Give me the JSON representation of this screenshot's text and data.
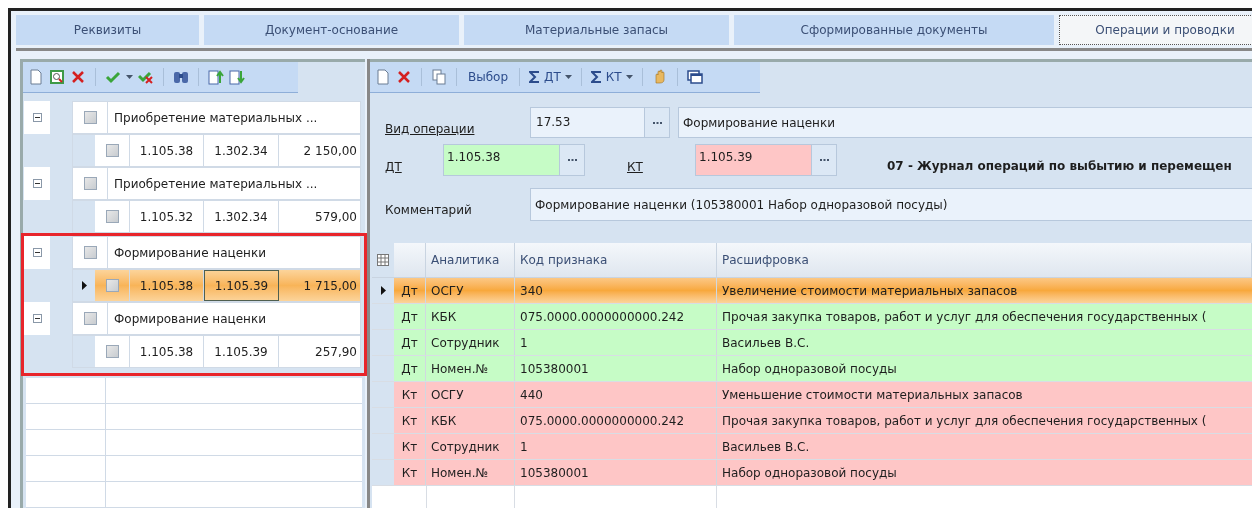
{
  "tabs": [
    {
      "label": "Реквизиты",
      "selected": false
    },
    {
      "label": "Документ-основание",
      "selected": false
    },
    {
      "label": "Материальные запасы",
      "selected": false
    },
    {
      "label": "Сформированные документы",
      "selected": false
    },
    {
      "label": "Операции и проводки",
      "selected": true
    }
  ],
  "tree": [
    {
      "label": "Приобретение материальных ...",
      "checked": false,
      "expanded": true,
      "highlighted": false,
      "children": [
        {
          "debit": "1.105.38",
          "credit": "1.302.34",
          "amount": "2 150,00",
          "checked": false,
          "selected": false
        }
      ]
    },
    {
      "label": "Приобретение материальных ...",
      "checked": false,
      "expanded": true,
      "highlighted": false,
      "children": [
        {
          "debit": "1.105.32",
          "credit": "1.302.34",
          "amount": "579,00",
          "checked": false,
          "selected": false
        }
      ]
    },
    {
      "label": "Формирование наценки",
      "checked": false,
      "expanded": true,
      "highlighted": true,
      "children": [
        {
          "debit": "1.105.38",
          "credit": "1.105.39",
          "amount": "1 715,00",
          "checked": false,
          "selected": true
        }
      ]
    },
    {
      "label": "Формирование наценки",
      "checked": false,
      "expanded": true,
      "highlighted": true,
      "children": [
        {
          "debit": "1.105.38",
          "credit": "1.105.39",
          "amount": "257,90",
          "checked": false,
          "selected": false
        }
      ]
    }
  ],
  "toolbar": {
    "choose": "Выбор",
    "sum_debit": "ДТ",
    "sum_credit": "КТ"
  },
  "form": {
    "operation_type": {
      "label": "Вид операции",
      "code": "17.53",
      "name": "Формирование наценки"
    },
    "debit": {
      "label": "ДТ",
      "value": "1.105.38"
    },
    "credit": {
      "label": "КТ",
      "value": "1.105.39"
    },
    "journal_title": "07 - Журнал операций по выбытию и перемещен",
    "comment": {
      "label": "Комментарий",
      "value": "Формирование наценки (105380001 Набор одноразовой посуды)"
    }
  },
  "grid": {
    "columns": [
      "Аналитика",
      "Код признака",
      "Расшифровка"
    ],
    "rows": [
      {
        "kind": "debit",
        "side": "Дт",
        "analytic": "ОСГУ",
        "code": "340",
        "description": "Увеличение стоимости материальных запасов",
        "selected": true
      },
      {
        "kind": "debit",
        "side": "Дт",
        "analytic": "КБК",
        "code": "075.0000.0000000000.242",
        "description": "Прочая закупка товаров, работ и услуг для обеспечения государственных (",
        "selected": false
      },
      {
        "kind": "debit",
        "side": "Дт",
        "analytic": "Сотрудник",
        "code": "1",
        "description": "Васильев В.С.",
        "selected": false
      },
      {
        "kind": "debit",
        "side": "Дт",
        "analytic": "Номен.№",
        "code": "105380001",
        "description": "Набор одноразовой посуды",
        "selected": false
      },
      {
        "kind": "credit",
        "side": "Кт",
        "analytic": "ОСГУ",
        "code": "440",
        "description": "Уменьшение стоимости материальных запасов",
        "selected": false
      },
      {
        "kind": "credit",
        "side": "Кт",
        "analytic": "КБК",
        "code": "075.0000.0000000000.242",
        "description": "Прочая закупка товаров, работ и услуг для обеспечения государственных (",
        "selected": false
      },
      {
        "kind": "credit",
        "side": "Кт",
        "analytic": "Сотрудник",
        "code": "1",
        "description": "Васильев В.С.",
        "selected": false
      },
      {
        "kind": "credit",
        "side": "Кт",
        "analytic": "Номен.№",
        "code": "105380001",
        "description": "Набор одноразовой посуды",
        "selected": false
      }
    ]
  }
}
